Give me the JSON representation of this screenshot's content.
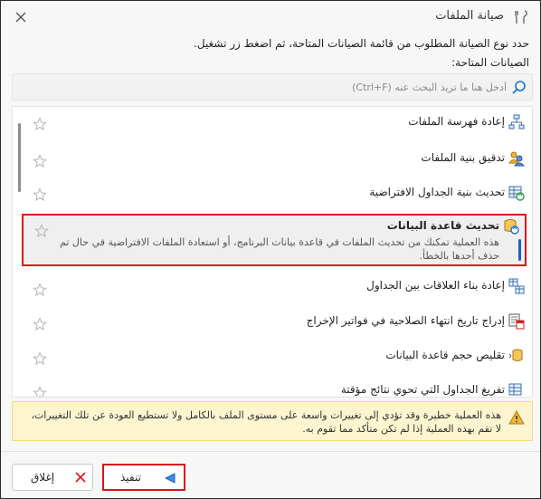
{
  "window": {
    "title": "صيانة الملفات",
    "instruction": "حدد نوع الصيانة المطلوب من قائمة الصيانات المتاحة، ثم اضغط زر تشغيل.",
    "available_label": "الصيانات المتاحة:"
  },
  "search": {
    "placeholder": "أدخل هنا ما تريد البحث عنه (Ctrl+F)"
  },
  "items": [
    {
      "label": "إعادة فهرسة الملفات",
      "icon": "sitemap-icon"
    },
    {
      "label": "تدقيق بنية الملفات",
      "icon": "audit-users-icon"
    },
    {
      "label": "تحديث بنية الجداول الافتراضية",
      "icon": "table-refresh-icon"
    },
    {
      "label": "تحديث قاعدة البيانات",
      "icon": "database-refresh-icon",
      "selected": true,
      "description": "هذه العملية تمكنك من تحديث الملفات في قاعدة بيانات البرنامج، أو استعادة الملفات الافتراضية في حال تم حذف أحدها بالخطأ."
    },
    {
      "label": "إعادة بناء العلاقات بين الجداول",
      "icon": "table-relations-icon"
    },
    {
      "label": "إدراج تاريخ انتهاء الصلاحية في فواتير الإخراج",
      "icon": "calendar-invoice-icon"
    },
    {
      "label": "تقليص حجم قاعدة البيانات",
      "icon": "database-shrink-icon"
    },
    {
      "label": "تفريغ الجداول التي تحوي نتائج مؤقتة",
      "icon": "table-clear-icon"
    }
  ],
  "warning": {
    "text": "هذه العملية خطيرة وقد تؤدي إلى تغييرات واسعة على مستوى الملف بالكامل ولا تستطيع العودة عن تلك التغييرات، لا تقم بهذه العملية إذا لم تكن متأكد مما تقوم به."
  },
  "buttons": {
    "close": "إغلاق",
    "run": "تنفيذ"
  },
  "colors": {
    "accent_red": "#d9141b",
    "warning_bg": "#fdf5cf",
    "selection_bar": "#1f5fbf"
  }
}
